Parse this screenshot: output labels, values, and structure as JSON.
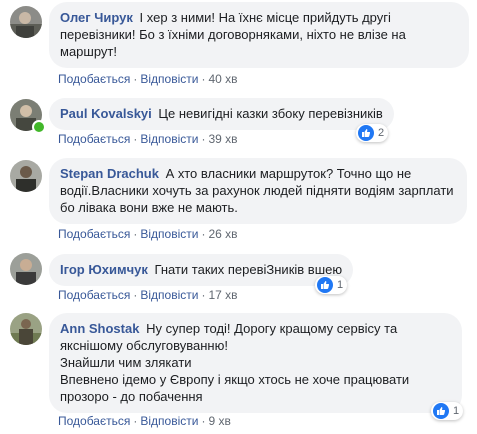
{
  "comments": [
    {
      "author": "Олег Чирук",
      "text": "І хер з ними! На їхнє місце прийдуть другі перевізники! Бо з їхніми договорняками, ніхто не влізе на маршрут!",
      "like": "Подобається",
      "reply": "Відповісти",
      "time": "40 хв"
    },
    {
      "author": "Paul Kovalskyi",
      "text": "Це невигідні казки збоку перевізників",
      "like": "Подобається",
      "reply": "Відповісти",
      "time": "39 хв",
      "reactions": "2"
    },
    {
      "author": "Stepan Drachuk",
      "text": "А хто власники маршруток? Точно що не водії.Власники хочуть за рахунок людей підняти водіям зарплати бо лівака вони вже не мають.",
      "like": "Подобається",
      "reply": "Відповісти",
      "time": "26 хв"
    },
    {
      "author": "Ігор Юхимчук",
      "text": "Гнати таких перевіЗників вшею",
      "like": "Подобається",
      "reply": "Відповісти",
      "time": "17 хв",
      "reactions": "1"
    },
    {
      "author": "Ann Shostak",
      "text_lines": [
        "Ну супер тоді! Дорогу кращому сервісу та якснішому обслуговуванню!",
        "Знайшли чим злякати",
        "Впевнено ідемо у Європу і якщо хтось не хоче працювати прозоро - до побачення"
      ],
      "like": "Подобається",
      "reply": "Відповісти",
      "time": "9 хв",
      "reactions": "1"
    }
  ],
  "colors": {
    "author": "#385898",
    "bubble": "#f2f3f5",
    "like_badge": "#2078f4",
    "online": "#42b72a"
  },
  "icons": [
    "avatar",
    "online-dot",
    "like-icon"
  ]
}
